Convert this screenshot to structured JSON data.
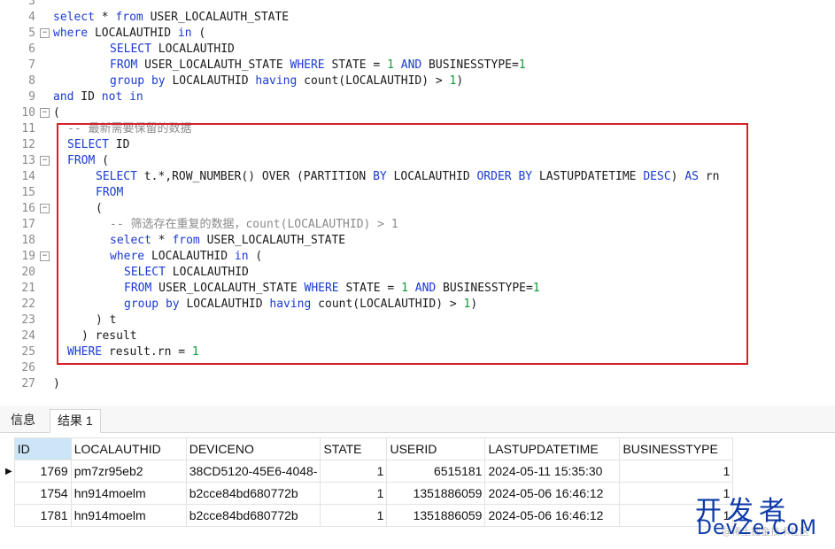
{
  "editor": {
    "lines": [
      {
        "n": "3",
        "parts": []
      },
      {
        "n": "4",
        "parts": [
          [
            "kw",
            "select"
          ],
          [
            "txt",
            " * "
          ],
          [
            "kw",
            "from"
          ],
          [
            "txt",
            " USER_LOCALAUTH_STATE"
          ]
        ]
      },
      {
        "n": "5",
        "fold": "−",
        "parts": [
          [
            "kw",
            "where"
          ],
          [
            "txt",
            " LOCALAUTHID "
          ],
          [
            "kw",
            "in"
          ],
          [
            "txt",
            " ("
          ]
        ]
      },
      {
        "n": "6",
        "indent": 64,
        "parts": [
          [
            "kw",
            "SELECT"
          ],
          [
            "txt",
            " LOCALAUTHID"
          ]
        ]
      },
      {
        "n": "7",
        "indent": 64,
        "parts": [
          [
            "kw",
            "FROM"
          ],
          [
            "txt",
            " USER_LOCALAUTH_STATE "
          ],
          [
            "kw",
            "WHERE"
          ],
          [
            "txt",
            " STATE = "
          ],
          [
            "num",
            "1"
          ],
          [
            "txt",
            " "
          ],
          [
            "kw",
            "AND"
          ],
          [
            "txt",
            " BUSINESSTYPE="
          ],
          [
            "num",
            "1"
          ]
        ]
      },
      {
        "n": "8",
        "indent": 64,
        "parts": [
          [
            "kw",
            "group by"
          ],
          [
            "txt",
            " LOCALAUTHID "
          ],
          [
            "kw",
            "having"
          ],
          [
            "txt",
            " count(LOCALAUTHID) > "
          ],
          [
            "num",
            "1"
          ],
          [
            "txt",
            ")"
          ]
        ]
      },
      {
        "n": "9",
        "parts": [
          [
            "kw",
            "and"
          ],
          [
            "txt",
            " ID "
          ],
          [
            "kw",
            "not in"
          ]
        ]
      },
      {
        "n": "10",
        "fold": "−",
        "parts": [
          [
            "txt",
            "("
          ]
        ]
      },
      {
        "n": "11",
        "indent": 16,
        "parts": [
          [
            "cmt",
            "-- 最新需要保留的数据"
          ]
        ]
      },
      {
        "n": "12",
        "indent": 16,
        "parts": [
          [
            "kw",
            "SELECT"
          ],
          [
            "txt",
            " ID"
          ]
        ]
      },
      {
        "n": "13",
        "fold": "−",
        "indent": 16,
        "parts": [
          [
            "kw",
            "FROM"
          ],
          [
            "txt",
            " ("
          ]
        ]
      },
      {
        "n": "14",
        "indent": 48,
        "parts": [
          [
            "kw",
            "SELECT"
          ],
          [
            "txt",
            " t.*,ROW_NUMBER() OVER (PARTITION "
          ],
          [
            "kw",
            "BY"
          ],
          [
            "txt",
            " LOCALAUTHID "
          ],
          [
            "kw",
            "ORDER BY"
          ],
          [
            "txt",
            " LASTUPDATETIME "
          ],
          [
            "kw",
            "DESC"
          ],
          [
            "txt",
            ") "
          ],
          [
            "kw",
            "AS"
          ],
          [
            "txt",
            " rn"
          ]
        ]
      },
      {
        "n": "15",
        "indent": 48,
        "parts": [
          [
            "kw",
            "FROM"
          ]
        ]
      },
      {
        "n": "16",
        "fold": "−",
        "indent": 48,
        "parts": [
          [
            "txt",
            "("
          ]
        ]
      },
      {
        "n": "17",
        "indent": 64,
        "parts": [
          [
            "cmt",
            "-- 筛选存在重复的数据，count(LOCALAUTHID) > 1"
          ]
        ]
      },
      {
        "n": "18",
        "indent": 64,
        "parts": [
          [
            "kw",
            "select"
          ],
          [
            "txt",
            " * "
          ],
          [
            "kw",
            "from"
          ],
          [
            "txt",
            " USER_LOCALAUTH_STATE"
          ]
        ]
      },
      {
        "n": "19",
        "fold": "−",
        "indent": 64,
        "parts": [
          [
            "kw",
            "where"
          ],
          [
            "txt",
            " LOCALAUTHID "
          ],
          [
            "kw",
            "in"
          ],
          [
            "txt",
            " ("
          ]
        ]
      },
      {
        "n": "20",
        "indent": 80,
        "parts": [
          [
            "kw",
            "SELECT"
          ],
          [
            "txt",
            " LOCALAUTHID"
          ]
        ]
      },
      {
        "n": "21",
        "indent": 80,
        "parts": [
          [
            "kw",
            "FROM"
          ],
          [
            "txt",
            " USER_LOCALAUTH_STATE "
          ],
          [
            "kw",
            "WHERE"
          ],
          [
            "txt",
            " STATE = "
          ],
          [
            "num",
            "1"
          ],
          [
            "txt",
            " "
          ],
          [
            "kw",
            "AND"
          ],
          [
            "txt",
            " BUSINESSTYPE="
          ],
          [
            "num",
            "1"
          ]
        ]
      },
      {
        "n": "22",
        "indent": 80,
        "parts": [
          [
            "kw",
            "group by"
          ],
          [
            "txt",
            " LOCALAUTHID "
          ],
          [
            "kw",
            "having"
          ],
          [
            "txt",
            " count(LOCALAUTHID) > "
          ],
          [
            "num",
            "1"
          ],
          [
            "txt",
            ")"
          ]
        ]
      },
      {
        "n": "23",
        "indent": 48,
        "parts": [
          [
            "txt",
            ") t"
          ]
        ]
      },
      {
        "n": "24",
        "indent": 32,
        "parts": [
          [
            "txt",
            ") result"
          ]
        ]
      },
      {
        "n": "25",
        "indent": 16,
        "parts": [
          [
            "kw",
            "WHERE"
          ],
          [
            "txt",
            " result.rn = "
          ],
          [
            "num",
            "1"
          ]
        ]
      },
      {
        "n": "26",
        "parts": []
      },
      {
        "n": "27",
        "parts": [
          [
            "txt",
            ")"
          ]
        ]
      }
    ]
  },
  "tabs": [
    {
      "label": "信息",
      "active": false
    },
    {
      "label": "结果 1",
      "active": true
    }
  ],
  "grid": {
    "columns": [
      "ID",
      "LOCALAUTHID",
      "DEVICENO",
      "STATE",
      "USERID",
      "LASTUPDATETIME",
      "BUSINESSTYPE"
    ],
    "rows": [
      [
        "1769",
        "pm7zr95eb2",
        "38CD5120-45E6-4048-",
        "1",
        "6515181",
        "2024-05-11 15:35:30",
        "1"
      ],
      [
        "1754",
        "hn914moelm",
        "b2cce84bd680772b",
        "1",
        "1351886059",
        "2024-05-06 16:46:12",
        "1"
      ],
      [
        "1781",
        "hn914moelm",
        "b2cce84bd680772b",
        "1",
        "1351886059",
        "2024-05-06 16:46:12",
        "1"
      ]
    ],
    "current_row_marker": "▶"
  },
  "watermark": {
    "cn": "开发者",
    "en": "DevZe.CoM",
    "faint": "@稀土掘金技术社区"
  },
  "colors": {
    "keyword": "#1a3bd1",
    "number": "#0a9a36",
    "comment": "#8a8a8a",
    "highlight_border": "#d7202a",
    "selected_header": "#cde6f7",
    "watermark": "#0d3aa8"
  }
}
